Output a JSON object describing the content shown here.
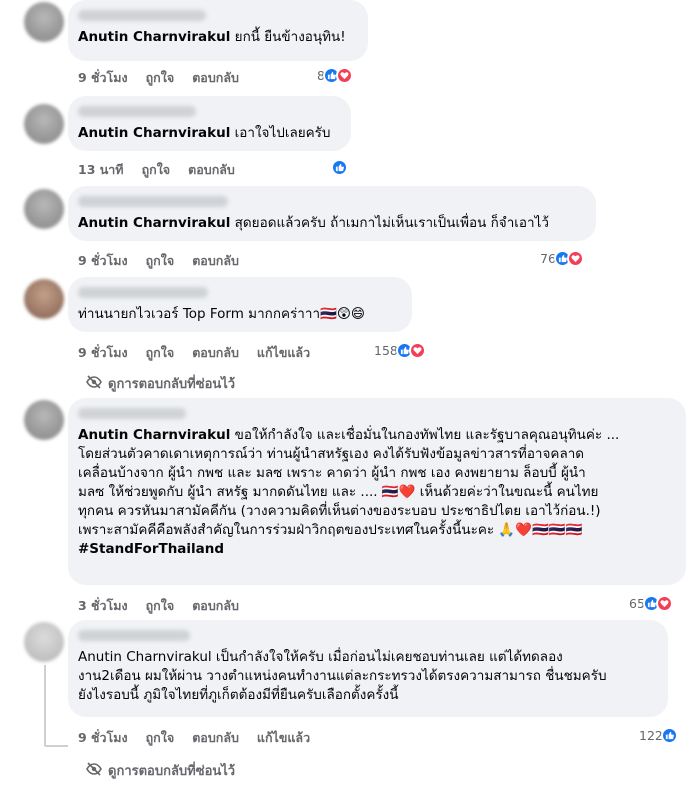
{
  "comments": [
    {
      "author_tag": "Anutin Charnvirakul",
      "text": " ยกนี้ ยืนข้างอนุทิน!",
      "time": "9 ชั่วโมง",
      "like_label": "ถูกใจ",
      "reply_label": "ตอบกลับ",
      "reaction_count": "8"
    },
    {
      "author_tag": "Anutin Charnvirakul",
      "text": " เอาใจไปเลยครับ",
      "time": "13 นาที",
      "like_label": "ถูกใจ",
      "reply_label": "ตอบกลับ",
      "reaction_count": ""
    },
    {
      "author_tag": "Anutin Charnvirakul",
      "text": " สุดยอดแล้วครับ ถ้าเมกาไม่เห็นเราเป็นเพื่อน ก็จำเอาไว้",
      "time": "9 ชั่วโมง",
      "like_label": "ถูกใจ",
      "reply_label": "ตอบกลับ",
      "reaction_count": "76"
    },
    {
      "author_tag": "",
      "text": "ท่านนายกไวเวอร์ Top Form มากกคร่าาา🇹🇭😲😄",
      "time": "9 ชั่วโมง",
      "like_label": "ถูกใจ",
      "reply_label": "ตอบกลับ",
      "edited_label": "แก้ไขแล้ว",
      "reaction_count": "158",
      "hidden_replies": "ดูการตอบกลับที่ซ่อนไว้"
    },
    {
      "author_tag": "Anutin Charnvirakul",
      "text": " ขอให้กำลังใจ และเชื่อมั่นในกองทัพไทย และรัฐบาลคุณอนุทินค่ะ ...\nโดยส่วนตัวคาดเดาเหตุการณ์ว่า ท่านผู้นำสหรัฐเอง คงได้รับฟังข้อมูลข่าวสารที่อาจคลาด\nเคลื่อนบ้างจาก ผู้นำ กพช และ มลซ เพราะ คาดว่า ผู้นำ กพช เอง คงพยายาม ล็อบบี้ ผู้นำ\nมลซ ให้ช่วยพูดกับ ผู้นำ สหรัฐ มากดดันไทย และ .... 🇹🇭❤️ เห็นด้วยค่ะว่าในขณะนี้ คนไทย\nทุกคน ควรหันมาสามัคคีกัน (วางความคิดที่เห็นต่างของระบอบ ประชาธิปไตย เอาไว้ก่อน.!)\nเพราะสามัคคีคือพลังสำคัญในการร่วมฝ่าวิกฤตของประเทศในครั้งนี้นะคะ 🙏❤️🇹🇭🇹🇭🇹🇭",
      "hashtag": "#StandForThailand",
      "time": "3 ชั่วโมง",
      "like_label": "ถูกใจ",
      "reply_label": "ตอบกลับ",
      "reaction_count": "65"
    },
    {
      "author_tag": "Anutin Charnvirakul",
      "text": " เป็นกำลังใจให้ครับ เมื่อก่อนไม่เคยชอบท่านเลย แต่ได้ทดลอง\nงาน2เดือน ผมให้ผ่าน วางตำแหน่งคนทำงานแต่ละกระทรวงได้ตรงความสามารถ ชื่นชมครับ\nยังไงรอบนี้ ภูมิใจไทยที่ภูเก็ตต้องมีที่ยืนครับเลือกตั้งครั้งนี้",
      "time": "9 ชั่วโมง",
      "like_label": "ถูกใจ",
      "reply_label": "ตอบกลับ",
      "edited_label": "แก้ไขแล้ว",
      "reaction_count": "122",
      "hidden_replies": "ดูการตอบกลับที่ซ่อนไว้"
    }
  ],
  "colors": {
    "like": "#1877f2",
    "love": "#f33e58",
    "bubble": "#f0f2f5",
    "meta": "#65676b"
  }
}
